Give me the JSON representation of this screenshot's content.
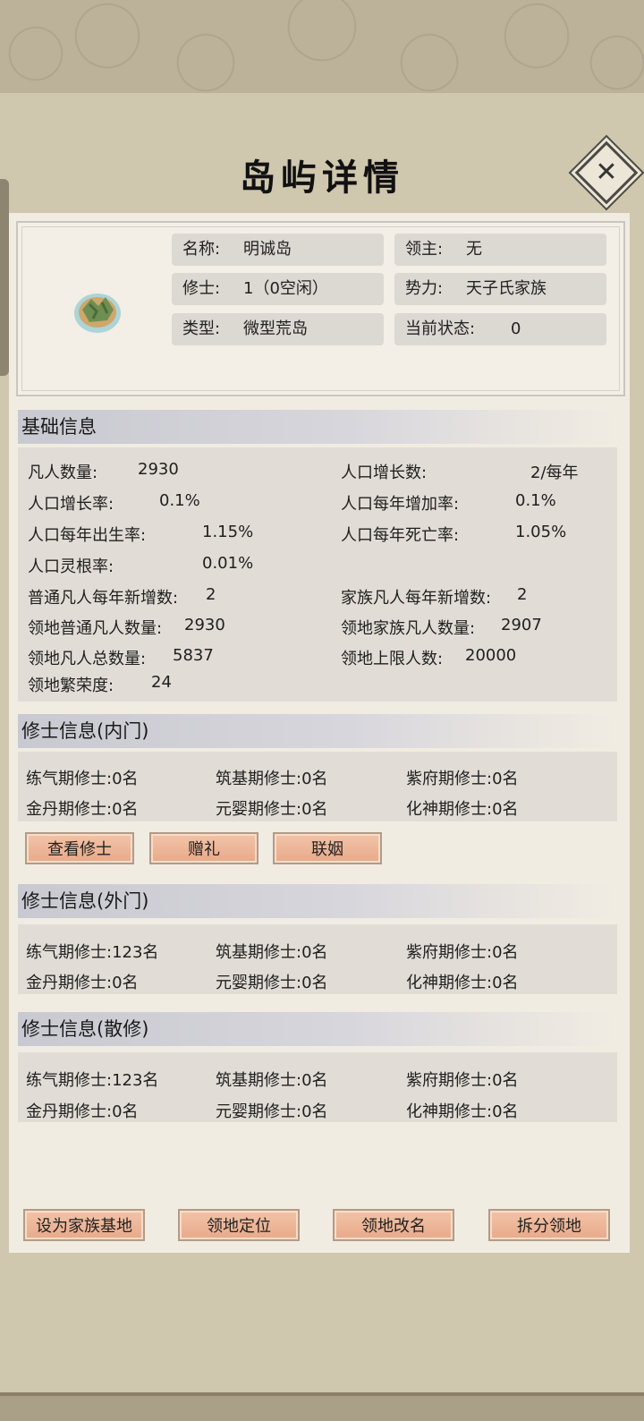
{
  "title": "岛屿详情",
  "close_glyph": "✕",
  "island": {
    "name_label": "名称:",
    "name": "明诚岛",
    "lord_label": "领主:",
    "lord": "无",
    "cultivator_label": "修士:",
    "cultivator": "1（0空闲）",
    "faction_label": "势力:",
    "faction": "天子氏家族",
    "type_label": "类型:",
    "type": "微型荒岛",
    "status_label": "当前状态:",
    "status": "0"
  },
  "basic": {
    "header": "基础信息",
    "rows": [
      {
        "label": "凡人数量:",
        "value": "2930"
      },
      {
        "label": "人口增长数:",
        "value": "2/每年"
      },
      {
        "label": "人口增长率:",
        "value": "0.1%"
      },
      {
        "label": "人口每年增加率:",
        "value": "0.1%"
      },
      {
        "label": "人口每年出生率:",
        "value": "1.15%"
      },
      {
        "label": "人口每年死亡率:",
        "value": "1.05%"
      },
      {
        "label": "人口灵根率:",
        "value": "0.01%"
      },
      {
        "label": "普通凡人每年新增数:",
        "value": "2"
      },
      {
        "label": "家族凡人每年新增数:",
        "value": "2"
      },
      {
        "label": "领地普通凡人数量:",
        "value": "2930"
      },
      {
        "label": "领地家族凡人数量:",
        "value": "2907"
      },
      {
        "label": "领地凡人总数量:",
        "value": "5837"
      },
      {
        "label": "领地上限人数:",
        "value": "20000"
      },
      {
        "label": "领地繁荣度:",
        "value": "24"
      }
    ]
  },
  "inner": {
    "header": "修士信息(内门)",
    "cells": [
      "练气期修士:0名",
      "筑基期修士:0名",
      "紫府期修士:0名",
      "金丹期修士:0名",
      "元婴期修士:0名",
      "化神期修士:0名"
    ],
    "buttons": [
      "查看修士",
      "赠礼",
      "联姻"
    ]
  },
  "outer": {
    "header": "修士信息(外门)",
    "cells": [
      "练气期修士:123名",
      "筑基期修士:0名",
      "紫府期修士:0名",
      "金丹期修士:0名",
      "元婴期修士:0名",
      "化神期修士:0名"
    ]
  },
  "loose": {
    "header": "修士信息(散修)",
    "cells": [
      "练气期修士:123名",
      "筑基期修士:0名",
      "紫府期修士:0名",
      "金丹期修士:0名",
      "元婴期修士:0名",
      "化神期修士:0名"
    ]
  },
  "bottom_buttons": [
    "设为家族基地",
    "领地定位",
    "领地改名",
    "拆分领地"
  ]
}
